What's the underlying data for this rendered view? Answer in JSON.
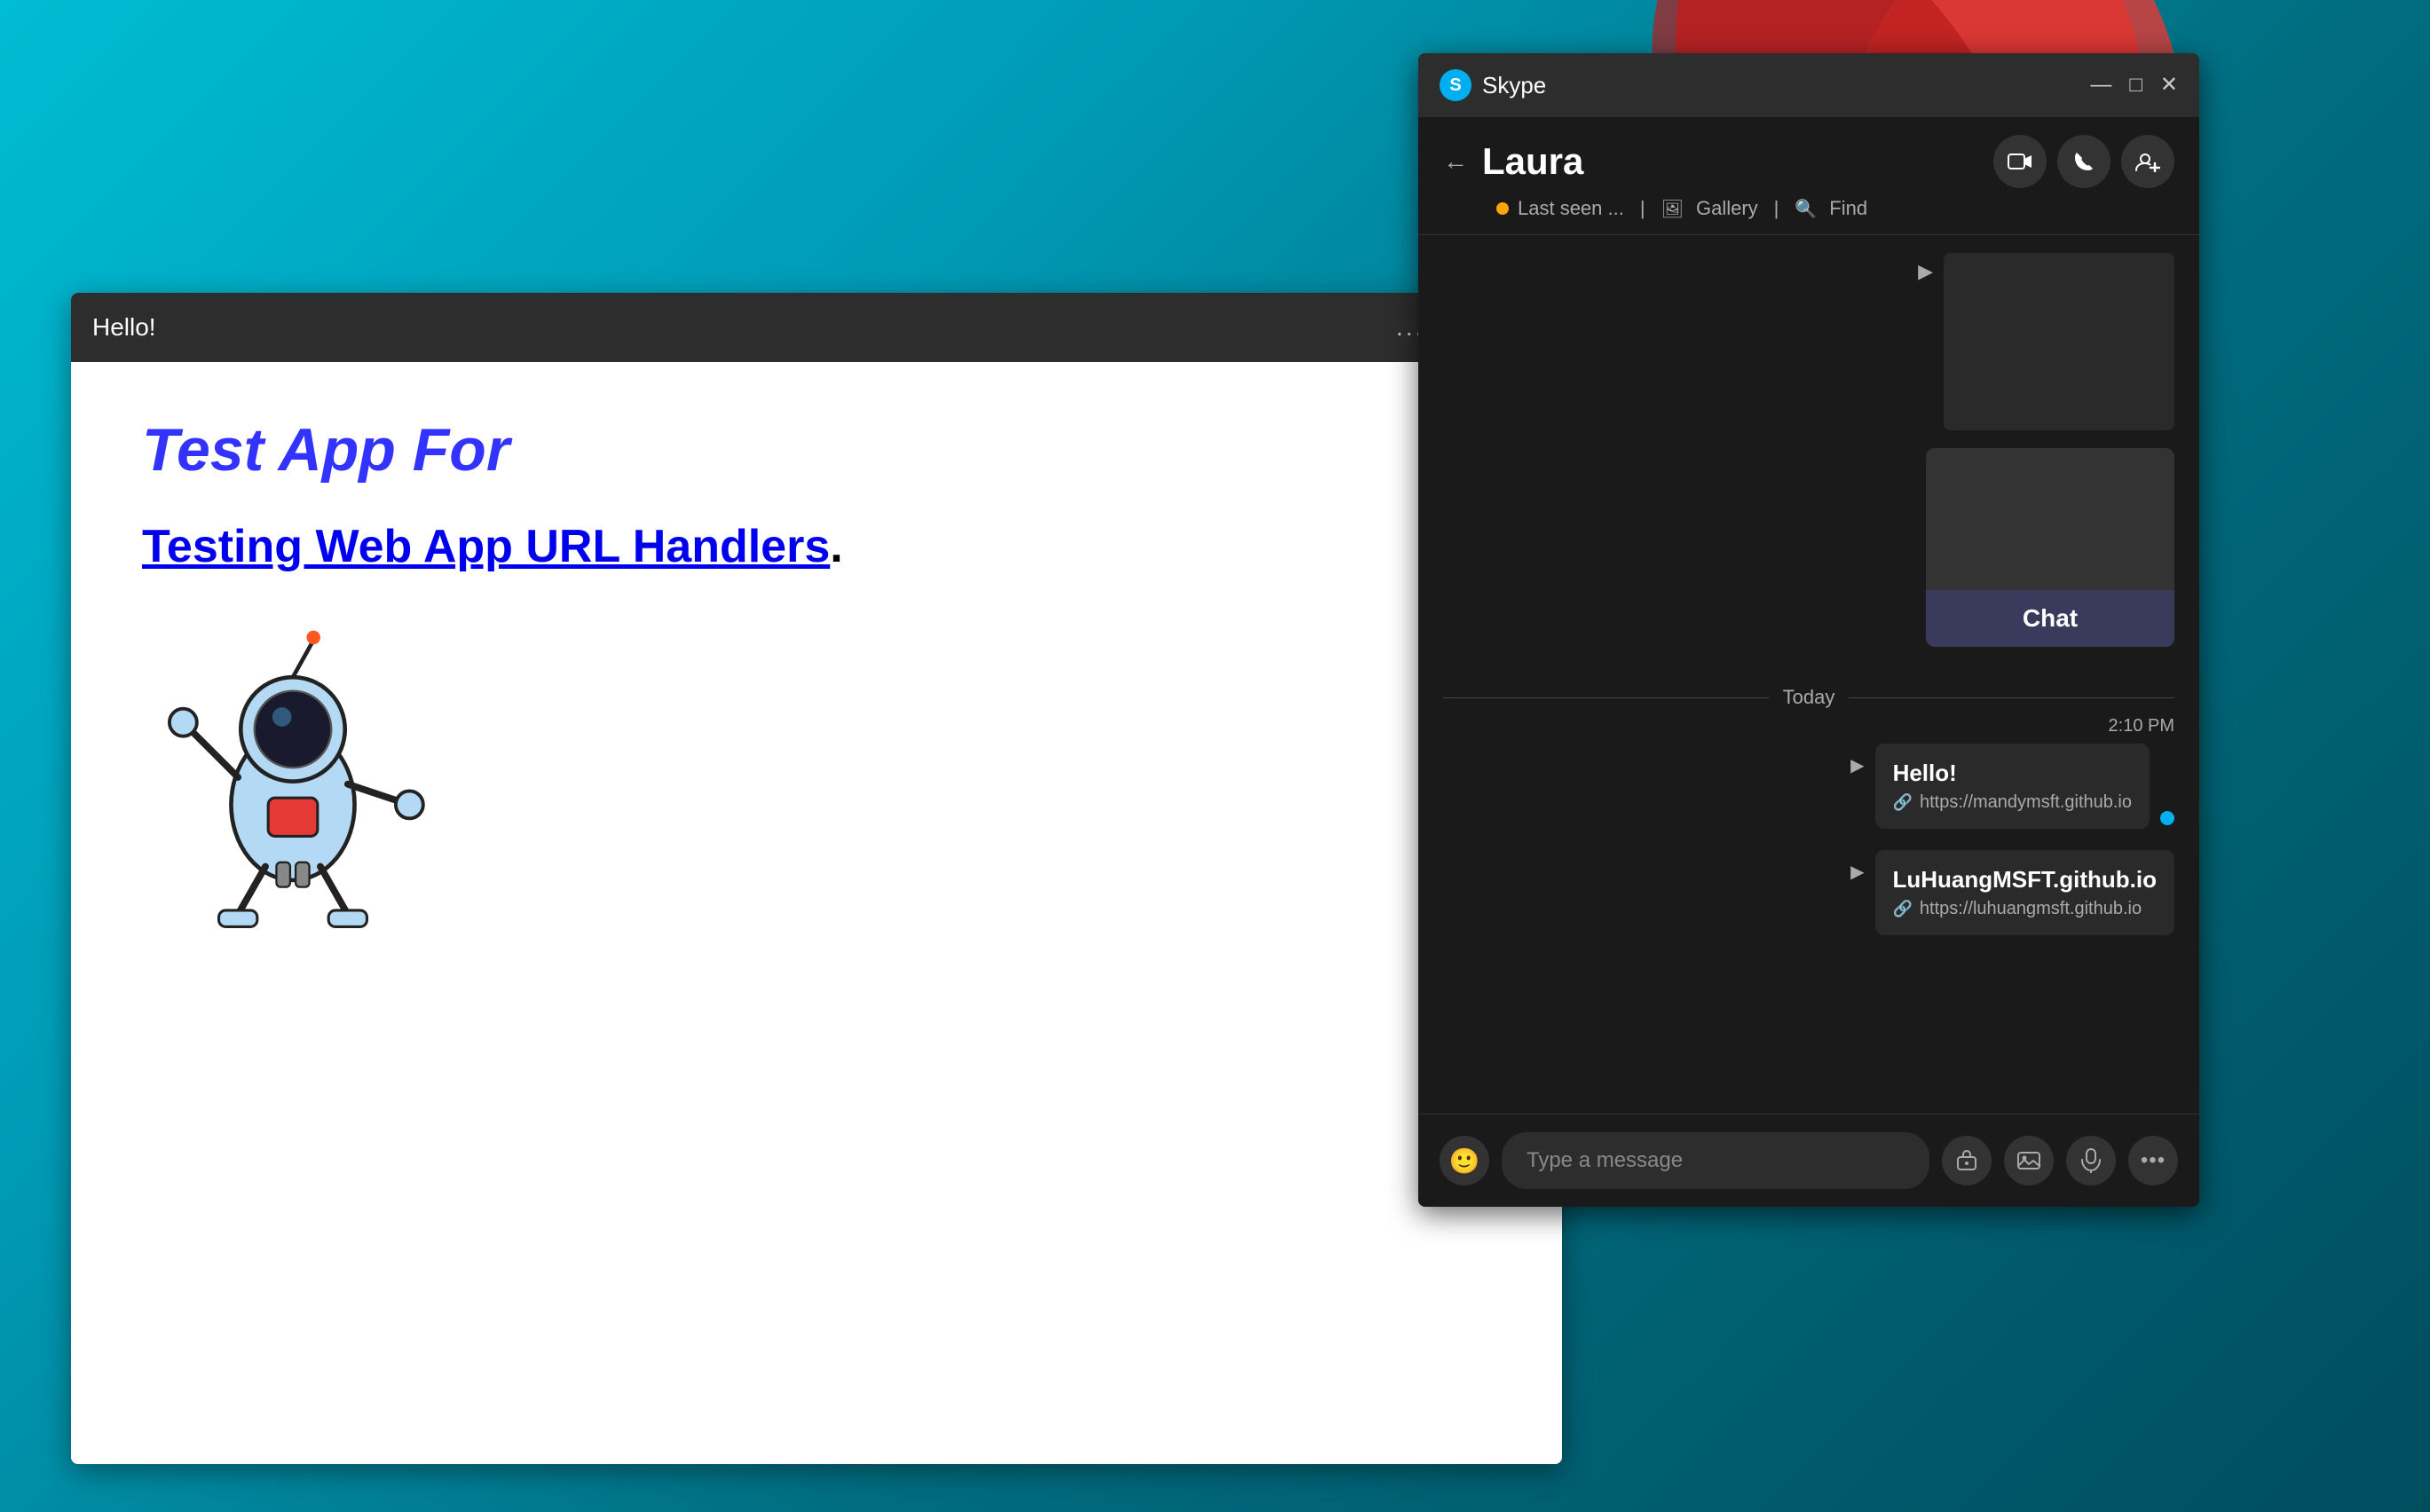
{
  "desktop": {
    "background_color": "#00bcd4"
  },
  "webapp": {
    "title": "Hello!",
    "heading": "Test App For",
    "link_text": "Testing Web App URL Handlers",
    "link_period": ".",
    "window_controls": {
      "dots": "...",
      "minimize": "—",
      "maximize": "□",
      "close": "✕"
    }
  },
  "skype": {
    "app_name": "Skype",
    "logo_letter": "S",
    "contact_name": "Laura",
    "status_text": "Last seen ...",
    "gallery_label": "Gallery",
    "find_label": "Find",
    "chat_label": "Chat",
    "today_label": "Today",
    "message_time": "2:10 PM",
    "messages": [
      {
        "id": 1,
        "text": "Hello!",
        "link": "https://mandymsft.github.io"
      },
      {
        "id": 2,
        "text": "LuHuangMSFT.github.io",
        "link": "https://luhuangmsft.github.io"
      }
    ],
    "input_placeholder": "Type a message",
    "window_controls": {
      "minimize": "—",
      "maximize": "□",
      "close": "✕"
    }
  }
}
